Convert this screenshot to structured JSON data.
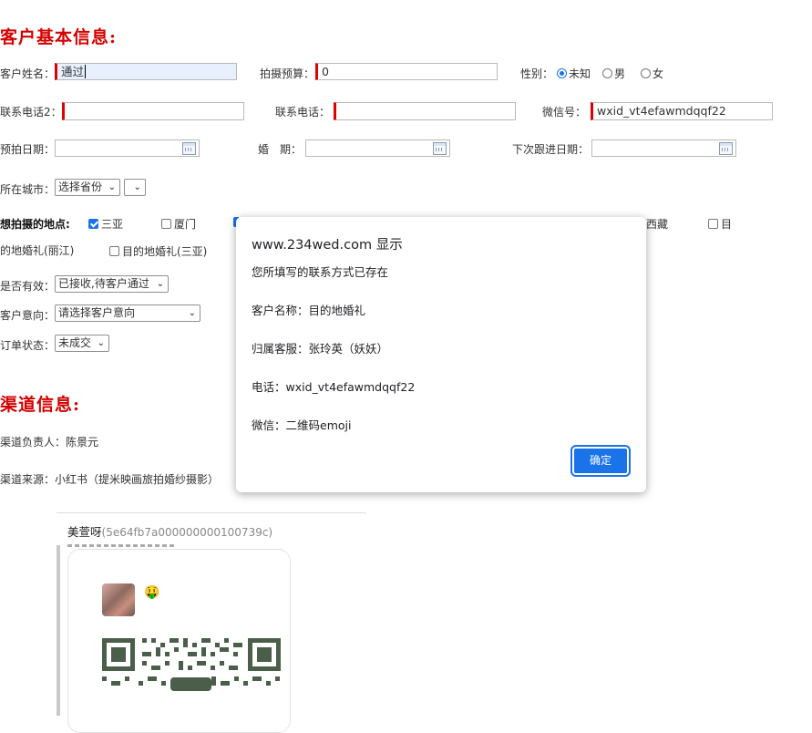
{
  "section_basic": {
    "title": "客户基本信息:"
  },
  "form": {
    "name_label": "客户姓名：",
    "name_value": "通过",
    "budget_label": "拍摄预算：",
    "budget_value": "0",
    "gender_label": "性别：",
    "gender_options": [
      "未知",
      "男",
      "女"
    ],
    "gender_selected": "未知",
    "phone2_label": "联系电话2：",
    "phone_label": "联系电话：",
    "wechat_label": "微信号：",
    "wechat_value": "wxid_vt4efawmdqqf22",
    "preshoot_date_label": "预拍日期：",
    "wedding_date_label": "婚　期：",
    "next_followup_label": "下次跟进日期：",
    "city_label": "所在城市：",
    "province_select": "选择省份",
    "city_select": "",
    "locations_label": "想拍摄的地点:",
    "locations": [
      {
        "label": "三亚",
        "checked": true
      },
      {
        "label": "厦门",
        "checked": false
      },
      {
        "label": "西藏",
        "checked": false
      },
      {
        "label": "目",
        "checked": false
      }
    ],
    "dest_wedding_lijiang": "的地婚礼(丽江)",
    "dest_wedding_sanya": "目的地婚礼(三亚)",
    "valid_label": "是否有效：",
    "valid_select": "已接收,待客户通过",
    "intent_label": "客户意向：",
    "intent_select": "请选择客户意向",
    "order_label": "订单状态：",
    "order_select": "未成交"
  },
  "section_channel": {
    "title": "渠道信息:"
  },
  "channel": {
    "owner_label": "渠道负责人：",
    "owner_value": "陈景元",
    "source_label": "渠道来源：",
    "source_value": "小红书（提米映画旅拍婚纱摄影）"
  },
  "chat": {
    "user_name": "美萱呀",
    "user_id": "(5e64fb7a000000000100739c)",
    "emoji": "🤑"
  },
  "dialog": {
    "title": "www.234wed.com 显示",
    "line1": "您所填写的联系方式已存在",
    "line2": "客户名称：目的地婚礼",
    "line3": "归属客服：张玲英（妖妖）",
    "line4": "电话：wxid_vt4efawmdqqf22",
    "line5": "微信：二维码emoji",
    "ok_label": "确定"
  },
  "colors": {
    "accent": "#1a73e8",
    "section_title": "#d40000",
    "required_bar": "#e00000",
    "qr": "#4a5e4a"
  }
}
